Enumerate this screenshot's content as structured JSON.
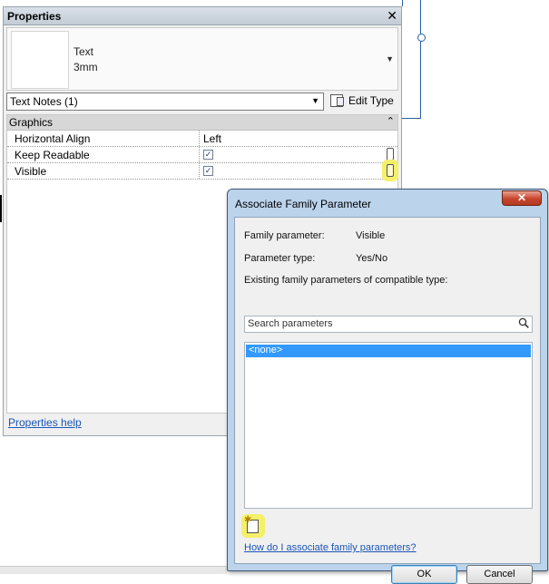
{
  "properties": {
    "title": "Properties",
    "close_glyph": "✕",
    "type_selector": {
      "family": "Text",
      "size": "3mm",
      "dropdown_glyph": "▼"
    },
    "filter": {
      "value": "Text Notes (1)",
      "arrow": "▼"
    },
    "edit_type_label": "Edit Type",
    "group": {
      "label": "Graphics",
      "collapse_glyph": "⌃"
    },
    "rows": [
      {
        "name": "Horizontal Align",
        "value": "Left"
      },
      {
        "name": "Keep Readable",
        "checked": true
      },
      {
        "name": "Visible",
        "checked": true
      }
    ],
    "help_link": "Properties help"
  },
  "dialog": {
    "title": "Associate Family Parameter",
    "close_glyph": "✕",
    "family_parameter_label": "Family parameter:",
    "family_parameter_value": "Visible",
    "parameter_type_label": "Parameter type:",
    "parameter_type_value": "Yes/No",
    "existing_label": "Existing family parameters of compatible type:",
    "search_placeholder": "Search parameters",
    "list_items": [
      "<none>"
    ],
    "help_link": "How do I associate family parameters?",
    "ok_label": "OK",
    "cancel_label": "Cancel"
  },
  "icons": {
    "check": "✓",
    "search": "search-icon",
    "new_parameter": "new-parameter-icon"
  },
  "colors": {
    "highlight": "#f4f06a",
    "selection": "#3399ff",
    "link": "#1a56b8"
  }
}
